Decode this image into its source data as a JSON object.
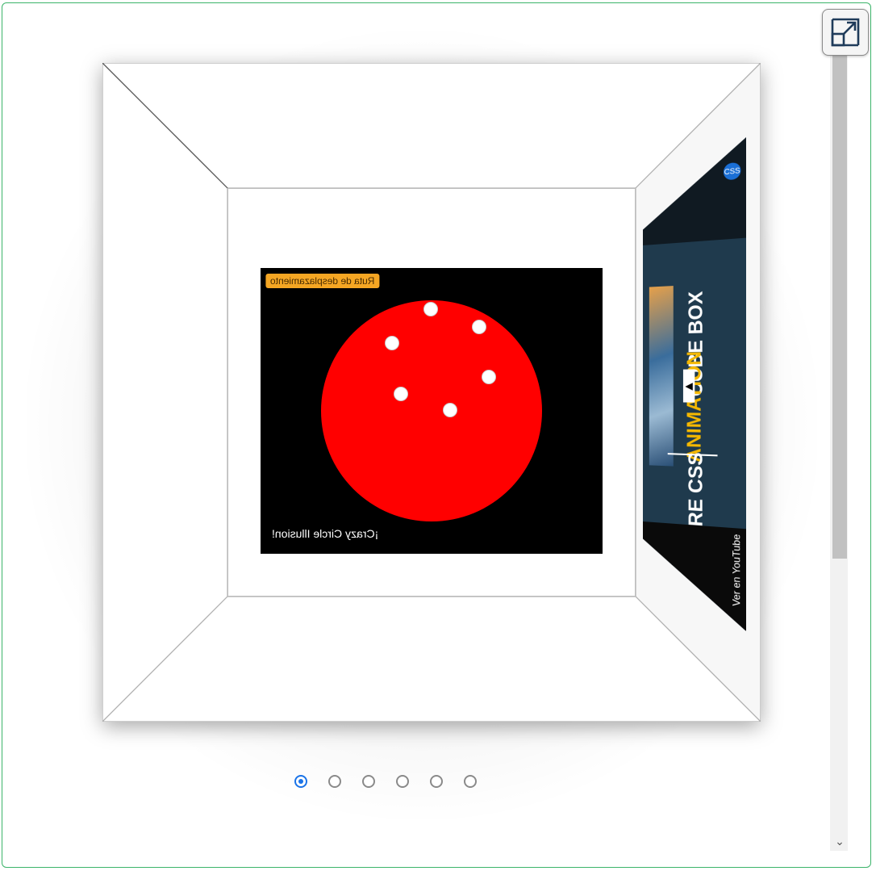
{
  "slide": {
    "route_button_label": "Ruta de desplazamiento",
    "caption": "¡Crazy Circle Illusion!",
    "colors": {
      "disc": "#ff0000",
      "background": "#000000",
      "route_button": "#f5a623"
    }
  },
  "side_slide": {
    "title_line1": "CUBE BOX",
    "title_line2": "ANIMATION",
    "title_line3": "PURE CSS",
    "footer": "Ver en YouTube"
  },
  "pager": {
    "count": 6,
    "active_index": 0,
    "active_color": "#1a73e8"
  },
  "controls": {
    "fullscreen_icon": "expand-icon",
    "scroll_down_icon": "chevron-down-icon",
    "scroll_down_glyph": "⌄"
  },
  "frame_color": "#3cb46a"
}
